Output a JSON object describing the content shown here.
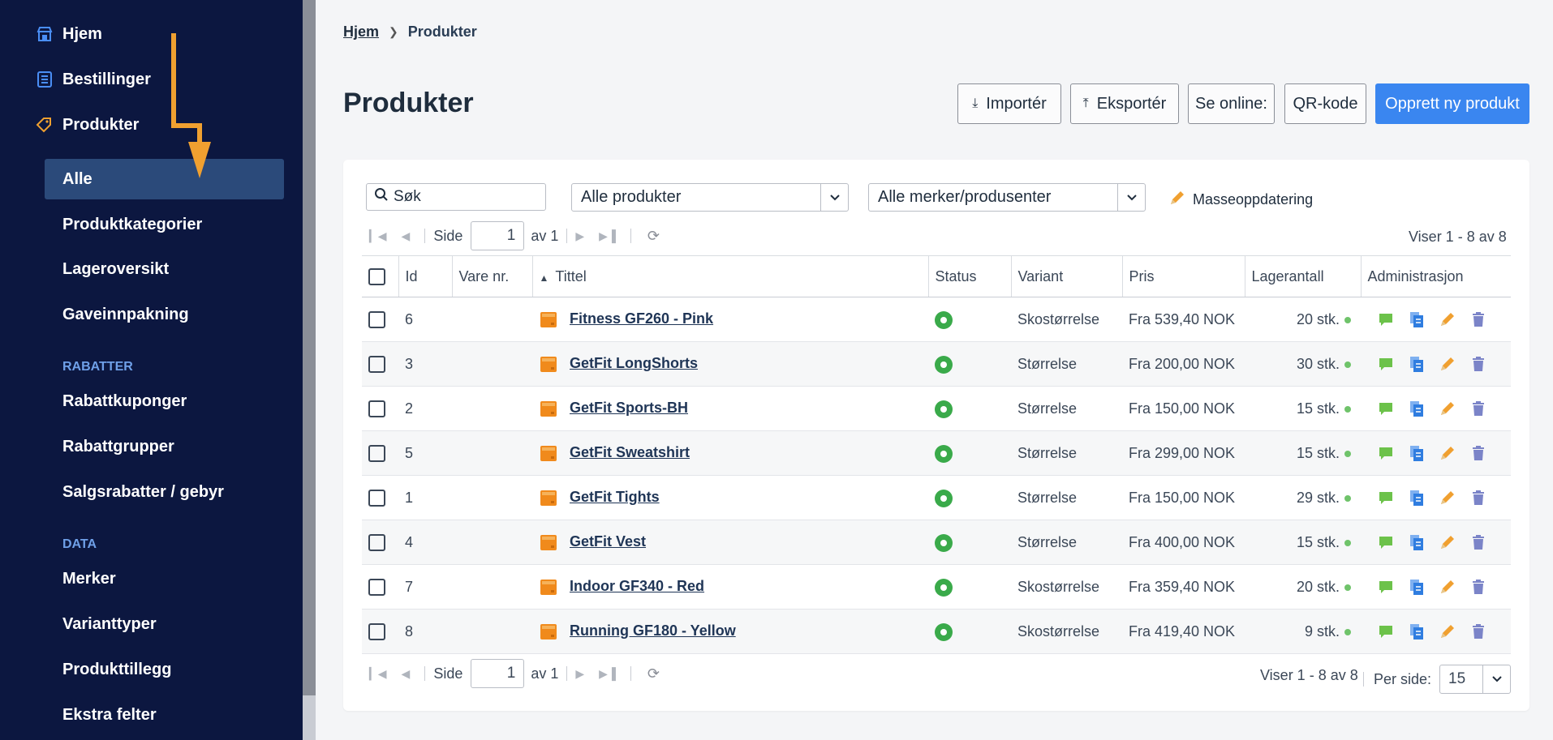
{
  "sidebar": {
    "top_items": [
      {
        "label": "Hjem",
        "icon": "store-icon"
      },
      {
        "label": "Bestillinger",
        "icon": "list-icon"
      },
      {
        "label": "Produkter",
        "icon": "tag-icon"
      }
    ],
    "product_sub": [
      "Alle",
      "Produktkategorier",
      "Lageroversikt",
      "Gaveinnpakning"
    ],
    "section_rabatter": "RABATTER",
    "rabatter": [
      "Rabattkuponger",
      "Rabattgrupper",
      "Salgsrabatter / gebyr"
    ],
    "section_data": "DATA",
    "data_items": [
      "Merker",
      "Varianttyper",
      "Produkttillegg",
      "Ekstra felter"
    ],
    "accent": "#f0a030"
  },
  "breadcrumb": {
    "home": "Hjem",
    "current": "Produkter"
  },
  "page_title": "Produkter",
  "buttons": {
    "import": "Importér",
    "export": "Eksportér",
    "online": "Se online:",
    "qr": "QR-kode",
    "create": "Opprett ny produkt"
  },
  "filters": {
    "search_placeholder": "Søk",
    "products_select": "Alle produkter",
    "brands_select": "Alle merker/produsenter",
    "mass_update": "Masseoppdatering"
  },
  "pager": {
    "side_label": "Side",
    "page": "1",
    "of_label": "av 1",
    "showing": "Viser 1 - 8 av 8",
    "per_side_label": "Per side:",
    "per_side_value": "15"
  },
  "table": {
    "headers": {
      "id": "Id",
      "sku": "Vare nr.",
      "title": "Tittel",
      "status": "Status",
      "variant": "Variant",
      "price": "Pris",
      "stock": "Lagerantall",
      "admin": "Administrasjon"
    },
    "rows": [
      {
        "id": "6",
        "sku": "",
        "title": "Fitness GF260 - Pink",
        "variant": "Skostørrelse",
        "price": "Fra 539,40 NOK",
        "stock": "20 stk."
      },
      {
        "id": "3",
        "sku": "",
        "title": "GetFit LongShorts",
        "variant": "Størrelse",
        "price": "Fra 200,00 NOK",
        "stock": "30 stk."
      },
      {
        "id": "2",
        "sku": "",
        "title": "GetFit Sports-BH",
        "variant": "Størrelse",
        "price": "Fra 150,00 NOK",
        "stock": "15 stk."
      },
      {
        "id": "5",
        "sku": "",
        "title": "GetFit Sweatshirt",
        "variant": "Størrelse",
        "price": "Fra 299,00 NOK",
        "stock": "15 stk."
      },
      {
        "id": "1",
        "sku": "",
        "title": "GetFit Tights",
        "variant": "Størrelse",
        "price": "Fra 150,00 NOK",
        "stock": "29 stk."
      },
      {
        "id": "4",
        "sku": "",
        "title": "GetFit Vest",
        "variant": "Størrelse",
        "price": "Fra 400,00 NOK",
        "stock": "15 stk."
      },
      {
        "id": "7",
        "sku": "",
        "title": "Indoor GF340 - Red",
        "variant": "Skostørrelse",
        "price": "Fra 359,40 NOK",
        "stock": "20 stk."
      },
      {
        "id": "8",
        "sku": "",
        "title": "Running GF180 - Yellow",
        "variant": "Skostørrelse",
        "price": "Fra 419,40 NOK",
        "stock": "9 stk."
      }
    ]
  }
}
